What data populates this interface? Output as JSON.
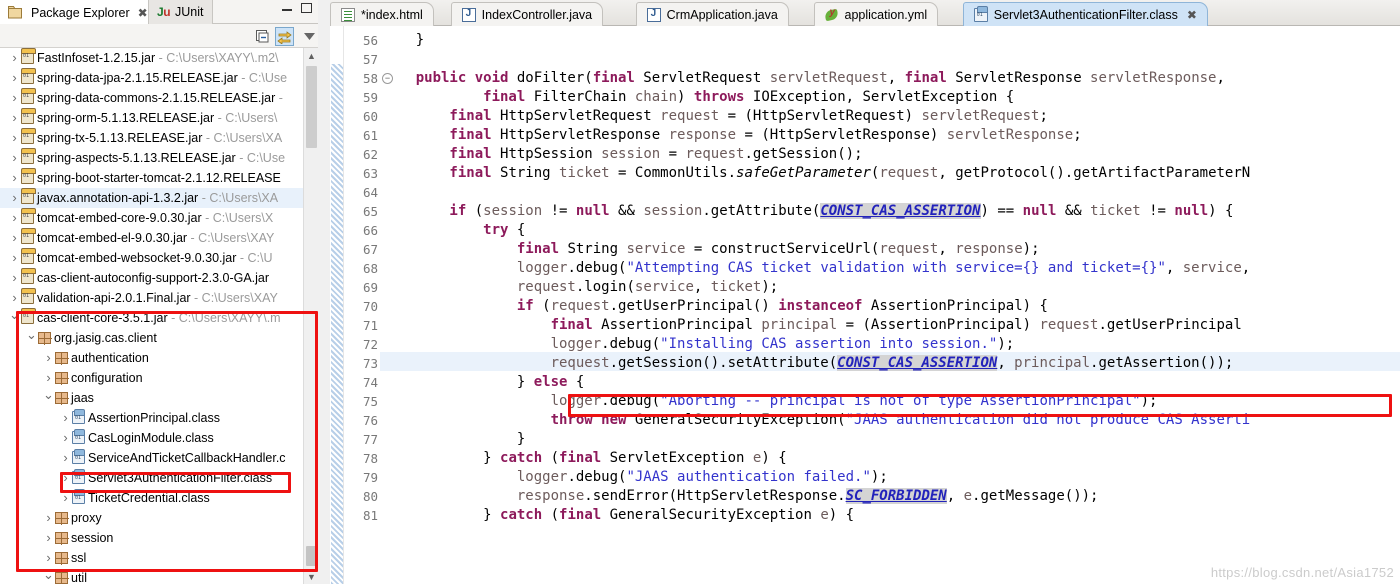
{
  "left_panel": {
    "tabs": [
      {
        "label": "Package Explorer",
        "icon": "package-explorer-icon",
        "active": true,
        "closable": true
      },
      {
        "label": "JUnit",
        "icon": "junit-icon",
        "active": false,
        "closable": false
      }
    ],
    "window_controls": {
      "minimize": "minimize-icon",
      "maximize": "maximize-icon"
    },
    "toolbar": [
      {
        "name": "collapse-all-button",
        "icon": "collapse-all-icon",
        "selected": false
      },
      {
        "name": "link-with-editor-button",
        "icon": "link-editor-icon",
        "selected": true
      },
      {
        "name": "view-menu-button",
        "icon": "chevron-down-icon",
        "selected": false
      }
    ],
    "tree": [
      {
        "indent": 0,
        "arrow": "closed",
        "icon": "jar-icon",
        "label": "FastInfoset-1.2.15.jar",
        "path": "- C:\\Users\\XAYY\\.m2\\",
        "highlight": false
      },
      {
        "indent": 0,
        "arrow": "closed",
        "icon": "jar-icon",
        "label": "spring-data-jpa-2.1.15.RELEASE.jar",
        "path": "- C:\\Use",
        "highlight": false
      },
      {
        "indent": 0,
        "arrow": "closed",
        "icon": "jar-icon",
        "label": "spring-data-commons-2.1.15.RELEASE.jar",
        "path": "-",
        "highlight": false
      },
      {
        "indent": 0,
        "arrow": "closed",
        "icon": "jar-icon",
        "label": "spring-orm-5.1.13.RELEASE.jar",
        "path": "- C:\\Users\\",
        "highlight": false
      },
      {
        "indent": 0,
        "arrow": "closed",
        "icon": "jar-icon",
        "label": "spring-tx-5.1.13.RELEASE.jar",
        "path": "- C:\\Users\\XA",
        "highlight": false
      },
      {
        "indent": 0,
        "arrow": "closed",
        "icon": "jar-icon",
        "label": "spring-aspects-5.1.13.RELEASE.jar",
        "path": "- C:\\Use",
        "highlight": false
      },
      {
        "indent": 0,
        "arrow": "closed",
        "icon": "jar-icon",
        "label": "spring-boot-starter-tomcat-2.1.12.RELEASE",
        "path": "",
        "highlight": false
      },
      {
        "indent": 0,
        "arrow": "closed",
        "icon": "jar-icon",
        "label": "javax.annotation-api-1.3.2.jar",
        "path": "- C:\\Users\\XA",
        "highlight": true
      },
      {
        "indent": 0,
        "arrow": "closed",
        "icon": "jar-icon",
        "label": "tomcat-embed-core-9.0.30.jar",
        "path": "- C:\\Users\\X",
        "highlight": false
      },
      {
        "indent": 0,
        "arrow": "closed",
        "icon": "jar-icon",
        "label": "tomcat-embed-el-9.0.30.jar",
        "path": "- C:\\Users\\XAY",
        "highlight": false
      },
      {
        "indent": 0,
        "arrow": "closed",
        "icon": "jar-icon",
        "label": "tomcat-embed-websocket-9.0.30.jar",
        "path": "- C:\\U",
        "highlight": false
      },
      {
        "indent": 0,
        "arrow": "closed",
        "icon": "jar-icon",
        "label": "cas-client-autoconfig-support-2.3.0-GA.jar",
        "path": "",
        "highlight": false
      },
      {
        "indent": 0,
        "arrow": "closed",
        "icon": "jar-icon",
        "label": "validation-api-2.0.1.Final.jar",
        "path": "- C:\\Users\\XAY",
        "highlight": false
      },
      {
        "indent": 0,
        "arrow": "open",
        "icon": "jar-icon",
        "label": "cas-client-core-3.5.1.jar",
        "path": "- C:\\Users\\XAYY\\.m",
        "highlight": false
      },
      {
        "indent": 1,
        "arrow": "open",
        "icon": "package-icon",
        "label": "org.jasig.cas.client",
        "path": "",
        "highlight": false
      },
      {
        "indent": 2,
        "arrow": "closed",
        "icon": "package-icon",
        "label": "authentication",
        "path": "",
        "highlight": false
      },
      {
        "indent": 2,
        "arrow": "closed",
        "icon": "package-icon",
        "label": "configuration",
        "path": "",
        "highlight": false
      },
      {
        "indent": 2,
        "arrow": "open",
        "icon": "package-icon",
        "label": "jaas",
        "path": "",
        "highlight": false
      },
      {
        "indent": 3,
        "arrow": "closed",
        "icon": "class-icon",
        "label": "AssertionPrincipal.class",
        "path": "",
        "highlight": false
      },
      {
        "indent": 3,
        "arrow": "closed",
        "icon": "class-icon",
        "label": "CasLoginModule.class",
        "path": "",
        "highlight": false
      },
      {
        "indent": 3,
        "arrow": "closed",
        "icon": "class-icon",
        "label": "ServiceAndTicketCallbackHandler.c",
        "path": "",
        "highlight": false
      },
      {
        "indent": 3,
        "arrow": "closed",
        "icon": "class-icon",
        "label": "Servlet3AuthenticationFilter.class",
        "path": "",
        "highlight": false
      },
      {
        "indent": 3,
        "arrow": "closed",
        "icon": "class-icon",
        "label": "TicketCredential.class",
        "path": "",
        "highlight": false
      },
      {
        "indent": 2,
        "arrow": "closed",
        "icon": "package-icon",
        "label": "proxy",
        "path": "",
        "highlight": false
      },
      {
        "indent": 2,
        "arrow": "closed",
        "icon": "package-icon",
        "label": "session",
        "path": "",
        "highlight": false
      },
      {
        "indent": 2,
        "arrow": "closed",
        "icon": "package-icon",
        "label": "ssl",
        "path": "",
        "highlight": false
      },
      {
        "indent": 2,
        "arrow": "open",
        "icon": "package-icon",
        "label": "util",
        "path": "",
        "highlight": false
      }
    ]
  },
  "editor": {
    "tabs": [
      {
        "label": "*index.html",
        "icon": "html-file-icon",
        "active": false,
        "closable": false
      },
      {
        "label": "IndexController.java",
        "icon": "java-file-icon",
        "active": false,
        "closable": false
      },
      {
        "label": "CrmApplication.java",
        "icon": "java-file-icon",
        "active": false,
        "closable": false
      },
      {
        "label": "application.yml",
        "icon": "yml-file-icon",
        "active": false,
        "closable": false
      },
      {
        "label": "Servlet3AuthenticationFilter.class",
        "icon": "class-file-icon",
        "active": true,
        "closable": true
      }
    ],
    "first_line_number": 56,
    "current_line": 73,
    "fold_line": 58,
    "lines": [
      {
        "n": 56,
        "tokens": [
          [
            "pl",
            "    }"
          ]
        ]
      },
      {
        "n": 57,
        "tokens": []
      },
      {
        "n": 58,
        "fold": true,
        "tokens": [
          [
            "kw",
            "    public void "
          ],
          [
            "pl",
            "doFilter("
          ],
          [
            "kw",
            "final "
          ],
          [
            "pl",
            "ServletRequest "
          ],
          [
            "id",
            "servletRequest"
          ],
          [
            "pl",
            ", "
          ],
          [
            "kw",
            "final "
          ],
          [
            "pl",
            "ServletResponse "
          ],
          [
            "id",
            "servletResponse"
          ],
          [
            "pl",
            ","
          ]
        ]
      },
      {
        "n": 59,
        "tokens": [
          [
            "kw",
            "            final "
          ],
          [
            "pl",
            "FilterChain "
          ],
          [
            "id",
            "chain"
          ],
          [
            "pl",
            ") "
          ],
          [
            "kw",
            "throws "
          ],
          [
            "pl",
            "IOException, ServletException {"
          ]
        ]
      },
      {
        "n": 60,
        "tokens": [
          [
            "kw",
            "        final "
          ],
          [
            "pl",
            "HttpServletRequest "
          ],
          [
            "id",
            "request"
          ],
          [
            "pl",
            " = (HttpServletRequest) "
          ],
          [
            "id",
            "servletRequest"
          ],
          [
            "pl",
            ";"
          ]
        ]
      },
      {
        "n": 61,
        "tokens": [
          [
            "kw",
            "        final "
          ],
          [
            "pl",
            "HttpServletResponse "
          ],
          [
            "id",
            "response"
          ],
          [
            "pl",
            " = (HttpServletResponse) "
          ],
          [
            "id",
            "servletResponse"
          ],
          [
            "pl",
            ";"
          ]
        ]
      },
      {
        "n": 62,
        "tokens": [
          [
            "kw",
            "        final "
          ],
          [
            "pl",
            "HttpSession "
          ],
          [
            "id",
            "session"
          ],
          [
            "pl",
            " = "
          ],
          [
            "id",
            "request"
          ],
          [
            "pl",
            ".getSession();"
          ]
        ]
      },
      {
        "n": 63,
        "tokens": [
          [
            "kw",
            "        final "
          ],
          [
            "pl",
            "String "
          ],
          [
            "id",
            "ticket"
          ],
          [
            "pl",
            " = CommonUtils."
          ],
          [
            "mth",
            "safeGetParameter"
          ],
          [
            "pl",
            "("
          ],
          [
            "id",
            "request"
          ],
          [
            "pl",
            ", getProtocol().getArtifactParameterN"
          ]
        ]
      },
      {
        "n": 64,
        "tokens": []
      },
      {
        "n": 65,
        "tokens": [
          [
            "kw",
            "        if "
          ],
          [
            "pl",
            "("
          ],
          [
            "id",
            "session"
          ],
          [
            "pl",
            " != "
          ],
          [
            "kw",
            "null"
          ],
          [
            "pl",
            " && "
          ],
          [
            "id",
            "session"
          ],
          [
            "pl",
            ".getAttribute("
          ],
          [
            "stc",
            "CONST_CAS_ASSERTION"
          ],
          [
            "pl",
            ") == "
          ],
          [
            "kw",
            "null"
          ],
          [
            "pl",
            " && "
          ],
          [
            "id",
            "ticket"
          ],
          [
            "pl",
            " != "
          ],
          [
            "kw",
            "null"
          ],
          [
            "pl",
            ") {"
          ]
        ]
      },
      {
        "n": 66,
        "tokens": [
          [
            "kw",
            "            try "
          ],
          [
            "pl",
            "{"
          ]
        ]
      },
      {
        "n": 67,
        "tokens": [
          [
            "kw",
            "                final "
          ],
          [
            "pl",
            "String "
          ],
          [
            "id",
            "service"
          ],
          [
            "pl",
            " = constructServiceUrl("
          ],
          [
            "id",
            "request"
          ],
          [
            "pl",
            ", "
          ],
          [
            "id",
            "response"
          ],
          [
            "pl",
            ");"
          ]
        ]
      },
      {
        "n": 68,
        "tokens": [
          [
            "id",
            "                logger"
          ],
          [
            "pl",
            ".debug("
          ],
          [
            "str",
            "\"Attempting CAS ticket validation with service={} and ticket={}\""
          ],
          [
            "pl",
            ", "
          ],
          [
            "id",
            "service"
          ],
          [
            "pl",
            ","
          ]
        ]
      },
      {
        "n": 69,
        "tokens": [
          [
            "id",
            "                request"
          ],
          [
            "pl",
            ".login("
          ],
          [
            "id",
            "service"
          ],
          [
            "pl",
            ", "
          ],
          [
            "id",
            "ticket"
          ],
          [
            "pl",
            ");"
          ]
        ]
      },
      {
        "n": 70,
        "tokens": [
          [
            "kw",
            "                if "
          ],
          [
            "pl",
            "("
          ],
          [
            "id",
            "request"
          ],
          [
            "pl",
            ".getUserPrincipal() "
          ],
          [
            "kw",
            "instanceof "
          ],
          [
            "pl",
            "AssertionPrincipal) {"
          ]
        ]
      },
      {
        "n": 71,
        "tokens": [
          [
            "kw",
            "                    final "
          ],
          [
            "pl",
            "AssertionPrincipal "
          ],
          [
            "id",
            "principal"
          ],
          [
            "pl",
            " = (AssertionPrincipal) "
          ],
          [
            "id",
            "request"
          ],
          [
            "pl",
            ".getUserPrincipal"
          ]
        ]
      },
      {
        "n": 72,
        "tokens": [
          [
            "id",
            "                    logger"
          ],
          [
            "pl",
            ".debug("
          ],
          [
            "str",
            "\"Installing CAS assertion into session.\""
          ],
          [
            "pl",
            ");"
          ]
        ]
      },
      {
        "n": 73,
        "tokens": [
          [
            "id",
            "                    request"
          ],
          [
            "pl",
            ".getSession().setAttribute("
          ],
          [
            "stc",
            "CONST_CAS_ASSERTION"
          ],
          [
            "pl",
            ", "
          ],
          [
            "id",
            "principal"
          ],
          [
            "pl",
            ".getAssertion());"
          ]
        ]
      },
      {
        "n": 74,
        "tokens": [
          [
            "pl",
            "                } "
          ],
          [
            "kw",
            "else "
          ],
          [
            "pl",
            "{"
          ]
        ]
      },
      {
        "n": 75,
        "tokens": [
          [
            "id",
            "                    logger"
          ],
          [
            "pl",
            ".debug("
          ],
          [
            "str",
            "\"Aborting -- principal is not of type AssertionPrincipal\""
          ],
          [
            "pl",
            ");"
          ]
        ]
      },
      {
        "n": 76,
        "tokens": [
          [
            "kw",
            "                    throw new "
          ],
          [
            "pl",
            "GeneralSecurityException("
          ],
          [
            "str",
            "\"JAAS authentication did not produce CAS Asserti"
          ]
        ]
      },
      {
        "n": 77,
        "tokens": [
          [
            "pl",
            "                }"
          ]
        ]
      },
      {
        "n": 78,
        "tokens": [
          [
            "pl",
            "            } "
          ],
          [
            "kw",
            "catch "
          ],
          [
            "pl",
            "("
          ],
          [
            "kw",
            "final "
          ],
          [
            "pl",
            "ServletException "
          ],
          [
            "id",
            "e"
          ],
          [
            "pl",
            ") {"
          ]
        ]
      },
      {
        "n": 79,
        "tokens": [
          [
            "id",
            "                logger"
          ],
          [
            "pl",
            ".debug("
          ],
          [
            "str",
            "\"JAAS authentication failed.\""
          ],
          [
            "pl",
            ");"
          ]
        ]
      },
      {
        "n": 80,
        "tokens": [
          [
            "id",
            "                response"
          ],
          [
            "pl",
            ".sendError(HttpServletResponse."
          ],
          [
            "stc",
            "SC_FORBIDDEN"
          ],
          [
            "pl",
            ", "
          ],
          [
            "id",
            "e"
          ],
          [
            "pl",
            ".getMessage());"
          ]
        ]
      },
      {
        "n": 81,
        "tokens": [
          [
            "pl",
            "            } "
          ],
          [
            "kw",
            "catch "
          ],
          [
            "pl",
            "("
          ],
          [
            "kw",
            "final "
          ],
          [
            "pl",
            "GeneralSecurityException "
          ],
          [
            "id",
            "e"
          ],
          [
            "pl",
            ") {"
          ]
        ]
      }
    ]
  },
  "watermark": "https://blog.csdn.net/Asia1752",
  "colors": {
    "keyword": "#8d1a5b",
    "string": "#3333cc",
    "static_field": "#2222bb",
    "identifier": "#6c5b5b",
    "annotation_red": "#ee1111",
    "current_line": "#eaf2fb",
    "active_tab": "#cfe3f6"
  }
}
